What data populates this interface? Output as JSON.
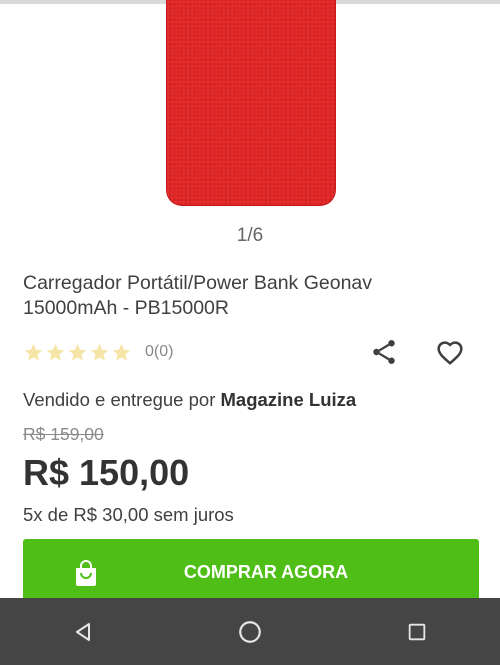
{
  "gallery": {
    "counter": "1/6"
  },
  "product": {
    "title": "Carregador Portátil/Power Bank Geonav 15000mAh - PB15000R",
    "rating": {
      "stars": 0,
      "max_stars": 5,
      "count_label": "0(0)"
    },
    "seller_prefix": "Vendido e entregue por ",
    "seller_name": "Magazine Luiza",
    "old_price": "R$ 159,00",
    "price": "R$ 150,00",
    "installments": "5x de R$ 30,00 sem juros"
  },
  "actions": {
    "buy_label": "COMPRAR AGORA",
    "share_icon": "share-icon",
    "favorite_icon": "heart-icon"
  },
  "colors": {
    "product_red": "#e02424",
    "buy_green": "#4fbf17",
    "star_empty": "#f5e6a8",
    "navbar": "#454545"
  }
}
